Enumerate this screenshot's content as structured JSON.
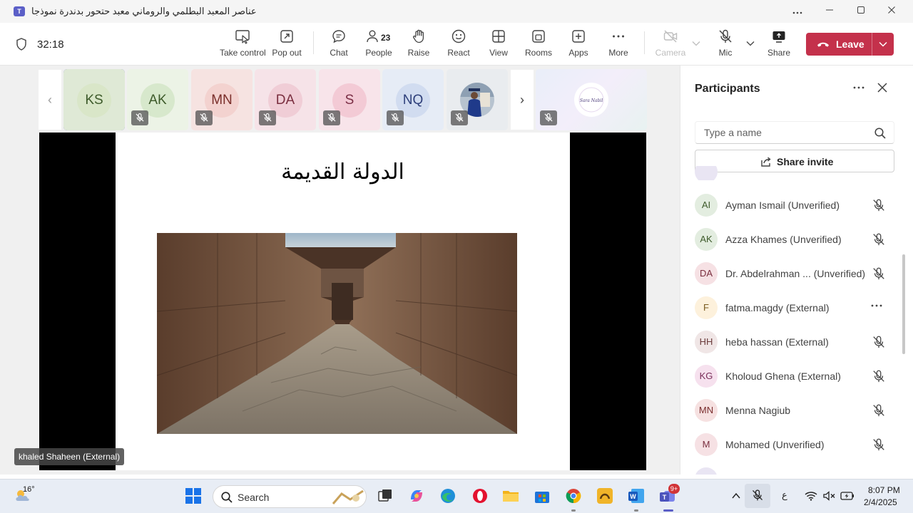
{
  "window": {
    "title": "عناصر المعبد البطلمي والروماني معبد حتحور بدندرة نموذجا",
    "controls": [
      "...",
      "—",
      "☐",
      "✕"
    ]
  },
  "toolbar": {
    "timer": "32:18",
    "buttons": {
      "take_control": "Take control",
      "pop_out": "Pop out",
      "chat": "Chat",
      "people": "People",
      "people_count": "23",
      "raise": "Raise",
      "react": "React",
      "view": "View",
      "rooms": "Rooms",
      "apps": "Apps",
      "more": "More",
      "camera": "Camera",
      "mic": "Mic",
      "share": "Share"
    },
    "leave": "Leave",
    "leave_color": "#c4314b",
    "accent": "#5b5fc7"
  },
  "stage": {
    "tiles": [
      {
        "initials": "KS",
        "bg": "#dfe9d6",
        "avatar": "#d9e6c8",
        "fg": "#3d5a2a",
        "selected": true
      },
      {
        "initials": "AK",
        "bg": "#ecf3e6",
        "avatar": "#d7e8cc",
        "fg": "#3d5a2a",
        "muted": true
      },
      {
        "initials": "MN",
        "bg": "#f6e3e1",
        "avatar": "#f3d2cf",
        "fg": "#7a2e2a",
        "muted": true
      },
      {
        "initials": "DA",
        "bg": "#f6e3e8",
        "avatar": "#f0cdd6",
        "fg": "#7a2e3f",
        "muted": true
      },
      {
        "initials": "S",
        "bg": "#f8e4ea",
        "avatar": "#f3cad5",
        "fg": "#7a2e45",
        "muted": true
      },
      {
        "initials": "NQ",
        "bg": "#e6ecf6",
        "avatar": "#d1dcf0",
        "fg": "#2e3f7a",
        "muted": true
      },
      {
        "initials": "",
        "bg": "#e9ecef",
        "muted": true,
        "photo": true
      },
      {
        "initials": "",
        "bg": "#e6eef8",
        "muted": true,
        "logo": true,
        "logo_text": "Sara Nabil"
      }
    ],
    "slide_title": "الدولة القديمة",
    "speaker_name": "khaled Shaheen (External)"
  },
  "pane": {
    "title": "Participants",
    "search_placeholder": "Type a name",
    "share_invite": "Share invite",
    "participants": [
      {
        "initials": "AI",
        "name": "Ayman Ismail (Unverified)",
        "av_bg": "#e3ede0",
        "av_fg": "#3d5a2a",
        "status": "muted"
      },
      {
        "initials": "AK",
        "name": "Azza Khames (Unverified)",
        "av_bg": "#e3ede0",
        "av_fg": "#3d5a2a",
        "status": "muted"
      },
      {
        "initials": "DA",
        "name": "Dr. Abdelrahman ... (Unverified)",
        "av_bg": "#f6e1e4",
        "av_fg": "#7a2e3f",
        "status": "muted"
      },
      {
        "initials": "F",
        "name": "fatma.magdy (External)",
        "av_bg": "#fdf1dc",
        "av_fg": "#7a5a1e",
        "status": "more"
      },
      {
        "initials": "HH",
        "name": "heba hassan (External)",
        "av_bg": "#f0e6e6",
        "av_fg": "#6a3a3a",
        "status": "muted"
      },
      {
        "initials": "KG",
        "name": "Kholoud Ghena (External)",
        "av_bg": "#f6e1ee",
        "av_fg": "#7a2e5a",
        "status": "muted"
      },
      {
        "initials": "MN",
        "name": "Menna Nagiub",
        "av_bg": "#f6e1e1",
        "av_fg": "#7a2e2e",
        "status": "muted"
      },
      {
        "initials": "M",
        "name": "Mohamed (Unverified)",
        "av_bg": "#f6e1e4",
        "av_fg": "#7a2e3f",
        "status": "muted"
      }
    ]
  },
  "taskbar": {
    "temperature": "16°",
    "search_label": "Search",
    "time": "8:07 PM",
    "date": "2/4/2025",
    "teams_badge": "9+",
    "input_lang": "ع"
  }
}
